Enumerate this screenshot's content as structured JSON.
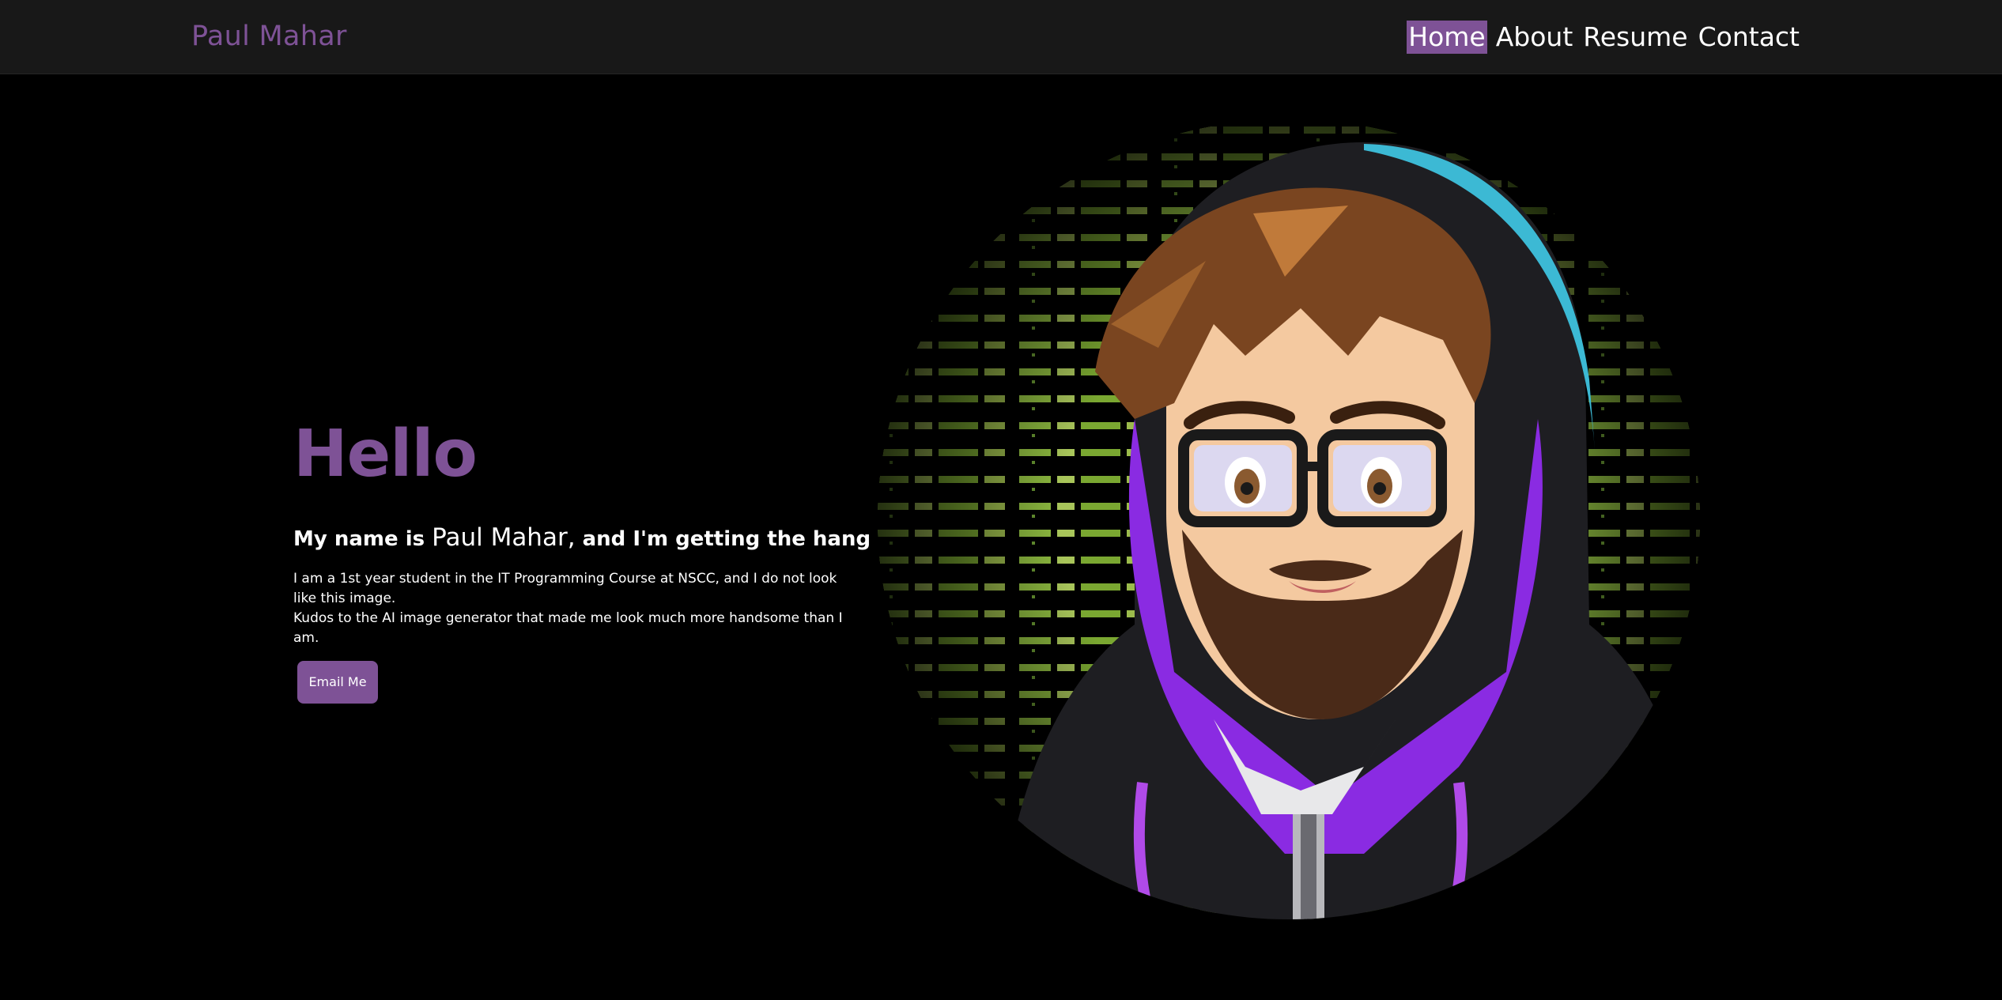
{
  "header": {
    "brand": "Paul Mahar",
    "nav": [
      {
        "label": "Home",
        "active": true
      },
      {
        "label": "About",
        "active": false
      },
      {
        "label": "Resume",
        "active": false
      },
      {
        "label": "Contact",
        "active": false
      }
    ]
  },
  "hero": {
    "greeting": "Hello",
    "intro_prefix": "My name is ",
    "intro_name": "Paul Mahar,",
    "intro_suffix": " and I'm getting the hang of this.",
    "description_line1": "I am a 1st year student in the IT Programming Course at NSCC, and I do not look like this image.",
    "description_line2": "Kudos to the AI image generator that made me look much more handsome than I am.",
    "button_label": "Email Me"
  },
  "avatar": {
    "description": "cartoon-hoodie-avatar",
    "colors": {
      "code_text": "#a5d84a",
      "hood": "#1e1e22",
      "purple": "#8a2be2",
      "hair": "#7a4520",
      "skin": "#f4c9a0",
      "beard": "#4a2a18",
      "accent": "#3cb9d4"
    }
  },
  "theme": {
    "accent": "#7e5296",
    "background": "#000000",
    "navbar": "#181818"
  }
}
